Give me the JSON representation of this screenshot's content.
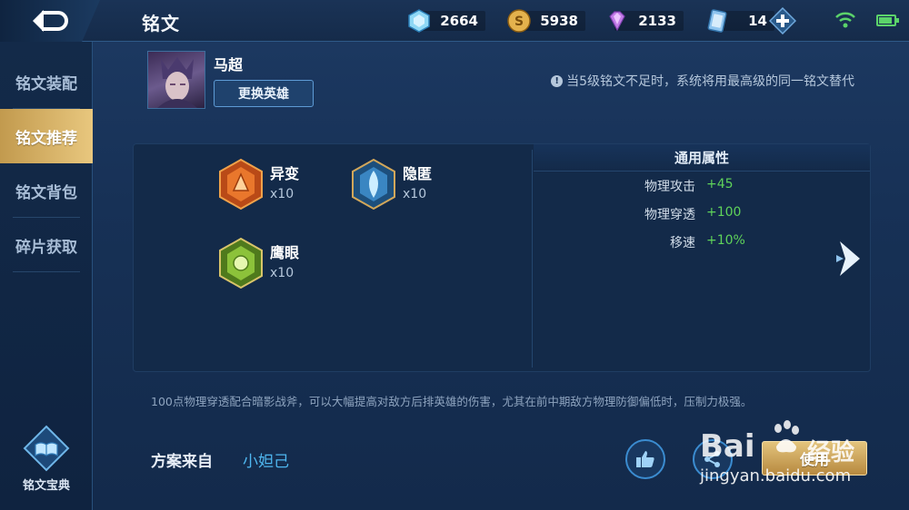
{
  "header": {
    "title": "铭文",
    "resources": [
      {
        "icon": "crystal-icon",
        "value": "2664"
      },
      {
        "icon": "gold-coin-icon",
        "value": "5938"
      },
      {
        "icon": "diamond-icon",
        "value": "2133"
      },
      {
        "icon": "ticket-card-icon",
        "value": "14"
      }
    ]
  },
  "sidebar": {
    "items": [
      {
        "label": "铭文装配"
      },
      {
        "label": "铭文推荐"
      },
      {
        "label": "铭文背包"
      },
      {
        "label": "碎片获取"
      }
    ],
    "codex_label": "铭文宝典"
  },
  "hero": {
    "name": "马超",
    "change_button": "更换英雄",
    "notice": "当5级铭文不足时，系统将用最高级的同一铭文替代"
  },
  "inscriptions": [
    {
      "name": "异变",
      "count": "x10",
      "color": "red"
    },
    {
      "name": "隐匿",
      "count": "x10",
      "color": "blue"
    },
    {
      "name": "鹰眼",
      "count": "x10",
      "color": "green"
    }
  ],
  "attributes": {
    "header": "通用属性",
    "rows": [
      {
        "key": "物理攻击",
        "value": "+45"
      },
      {
        "key": "物理穿透",
        "value": "+100"
      },
      {
        "key": "移速",
        "value": "+10%"
      }
    ]
  },
  "description": "100点物理穿透配合暗影战斧，可以大幅提高对敌方后排英雄的伤害，尤其在前中期敌方物理防御偏低时，压制力极强。",
  "source": {
    "label": "方案来自",
    "author": "小妲己"
  },
  "actions": {
    "use_button": "使用"
  },
  "watermark": {
    "brand": "Bai",
    "brand_cn": "经验",
    "url": "jingyan.baidu.com"
  },
  "colors": {
    "accent_gold": "#d9b56a",
    "value_green": "#5fd35a",
    "link_blue": "#4fb7f0"
  }
}
